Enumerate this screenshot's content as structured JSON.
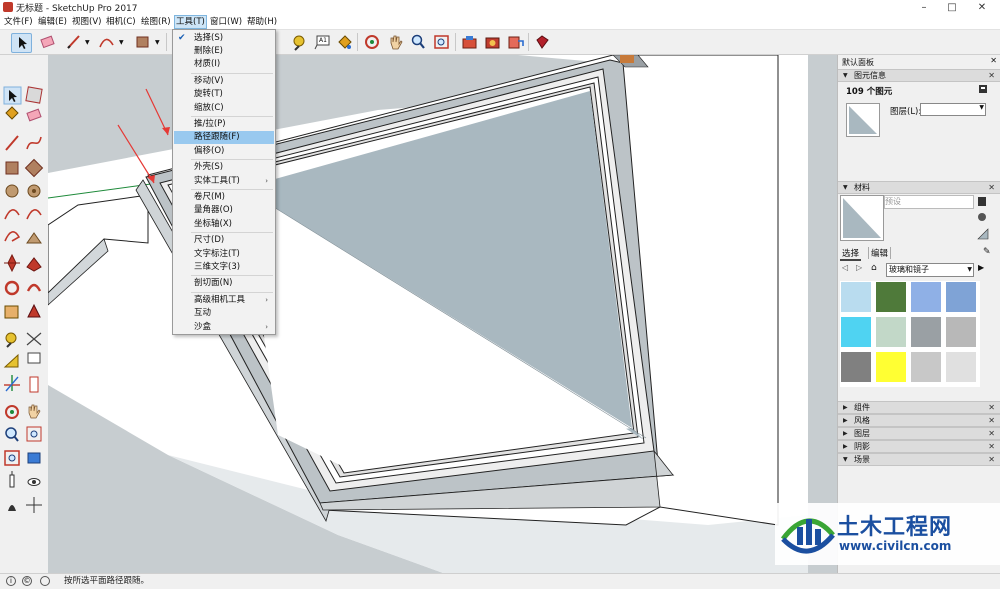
{
  "window": {
    "title": "无标题 - SketchUp Pro 2017",
    "min_glyph": "–",
    "max_glyph": "□",
    "close_glyph": "✕"
  },
  "menubar": {
    "items": [
      {
        "label": "文件(F)"
      },
      {
        "label": "编辑(E)"
      },
      {
        "label": "视图(V)"
      },
      {
        "label": "相机(C)"
      },
      {
        "label": "绘图(R)"
      },
      {
        "label": "工具(T)"
      },
      {
        "label": "窗口(W)"
      },
      {
        "label": "帮助(H)"
      }
    ],
    "active_index": 5
  },
  "tools_menu": {
    "checked_index": 0,
    "highlighted_index": 7,
    "groups": [
      [
        {
          "label": "选择(S)"
        },
        {
          "label": "删除(E)"
        },
        {
          "label": "材质(I)"
        }
      ],
      [
        {
          "label": "移动(V)"
        },
        {
          "label": "旋转(T)"
        },
        {
          "label": "缩放(C)"
        }
      ],
      [
        {
          "label": "推/拉(P)"
        },
        {
          "label": "路径跟随(F)"
        },
        {
          "label": "偏移(O)"
        }
      ],
      [
        {
          "label": "外壳(S)"
        },
        {
          "label": "实体工具(T)",
          "submenu": true
        }
      ],
      [
        {
          "label": "卷尺(M)"
        },
        {
          "label": "量角器(O)"
        },
        {
          "label": "坐标轴(X)"
        }
      ],
      [
        {
          "label": "尺寸(D)"
        },
        {
          "label": "文字标注(T)"
        },
        {
          "label": "三维文字(3)"
        }
      ],
      [
        {
          "label": "剖切面(N)"
        }
      ],
      [
        {
          "label": "高级相机工具",
          "submenu": true
        },
        {
          "label": "互动"
        },
        {
          "label": "沙盒",
          "submenu": true
        }
      ]
    ],
    "submenu_glyph": "›",
    "check_glyph": "✔"
  },
  "toolbar": {
    "text_tool_glyph": "A1"
  },
  "panel": {
    "title": "默认面板",
    "entity_info": {
      "header": "图元信息",
      "count": "109 个图元",
      "layer_label": "图层(L):",
      "layer_value": ""
    },
    "materials": {
      "header": "材料",
      "name_placeholder": "预设",
      "tab_select": "选择",
      "tab_edit": "编辑",
      "library": "玻璃和镜子"
    },
    "collapsed": [
      {
        "label": "组件"
      },
      {
        "label": "风格"
      },
      {
        "label": "图层"
      },
      {
        "label": "阴影"
      },
      {
        "label": "场景",
        "expanded": true
      }
    ],
    "swatch_colors": [
      "#b9dcef",
      "#4f7a3a",
      "#8fb0e6",
      "#7fa3d6",
      "#4fd3f2",
      "#c2d8c8",
      "#9aa0a4",
      "#b8b8b8",
      "#808080",
      "#ffff33",
      "#c8c8c8",
      "#e0e0e0"
    ]
  },
  "statusbar": {
    "text": "按所选平面路径跟随。",
    "icon1": "i",
    "icon2": "©"
  },
  "watermark": {
    "cn": "土木工程网",
    "url": "www.civilcn.com"
  },
  "colors": {
    "model_gray": "#a9b8c0",
    "highlight": "#99c9ef",
    "wm_blue": "#1b4fa0",
    "wm_green": "#3aa535"
  }
}
